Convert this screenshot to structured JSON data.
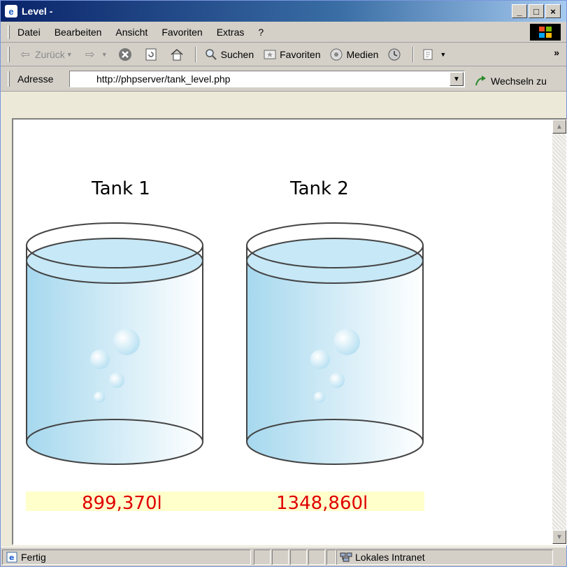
{
  "window": {
    "title": "Level -"
  },
  "menu": {
    "items": [
      "Datei",
      "Bearbeiten",
      "Ansicht",
      "Favoriten",
      "Extras",
      "?"
    ]
  },
  "toolbar": {
    "back_label": "Zurück",
    "search_label": "Suchen",
    "favorites_label": "Favoriten",
    "media_label": "Medien"
  },
  "address": {
    "label": "Adresse",
    "url": "http://phpserver/tank_level.php",
    "go_label": "Wechseln zu"
  },
  "tanks": [
    {
      "name": "Tank 1",
      "level": "899,370l"
    },
    {
      "name": "Tank 2",
      "level": "1348,860l"
    }
  ],
  "colors": {
    "level_text": "#e00000",
    "level_bg": "#ffffcc",
    "water": "#a9d9ee"
  },
  "status": {
    "left": "Fertig",
    "zone": "Lokales Intranet"
  }
}
